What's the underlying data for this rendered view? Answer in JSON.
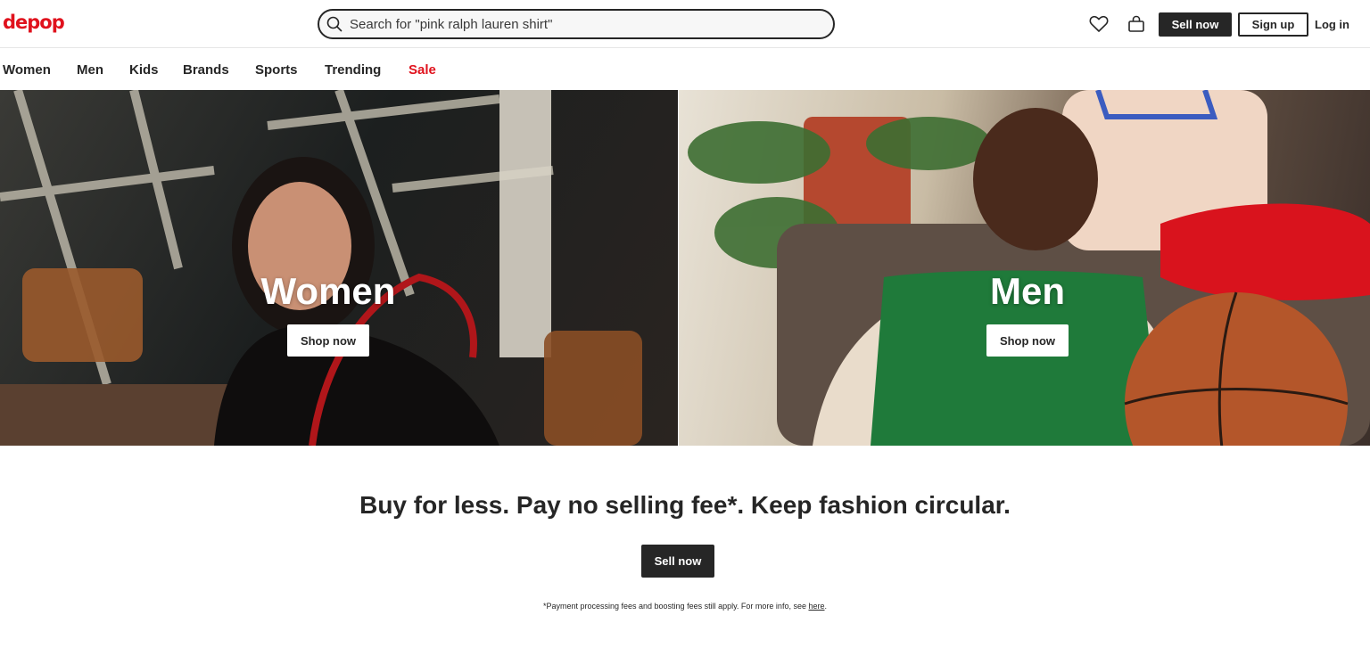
{
  "header": {
    "logo_text": "depop",
    "search_placeholder": "Search for \"pink ralph lauren shirt\"",
    "sell_now": "Sell now",
    "sign_up": "Sign up",
    "log_in": "Log in",
    "icons": [
      "search-icon",
      "heart-icon",
      "bag-icon"
    ]
  },
  "nav": {
    "items": [
      "Women",
      "Men",
      "Kids",
      "Brands",
      "Sports",
      "Trending",
      "Sale"
    ],
    "sale_color": "#e0121d"
  },
  "hero": {
    "women": {
      "title": "Women",
      "button": "Shop now"
    },
    "men": {
      "title": "Men",
      "button": "Shop now"
    }
  },
  "promo": {
    "tagline": "Buy for less. Pay no selling fee*. Keep fashion circular.",
    "sell_now": "Sell now",
    "footnote_text": "*Payment processing fees and boosting fees still apply. For more info, see",
    "footnote_link": "here",
    "footnote_end": "."
  },
  "colors": {
    "brand_red": "#e0121d",
    "dark": "#262626"
  }
}
